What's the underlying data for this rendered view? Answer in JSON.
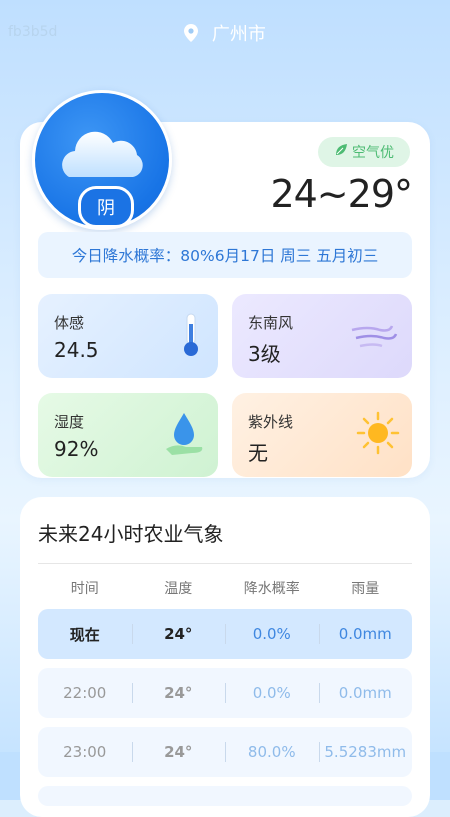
{
  "watermark": "fb3b5d",
  "location": {
    "city": "广州市"
  },
  "current": {
    "condition": "阴",
    "air_quality": "空气优",
    "temp_range": "24~29°",
    "precip_line": "今日降水概率：80%6月17日 周三 五月初三"
  },
  "tiles": {
    "feel": {
      "label": "体感",
      "value": "24.5",
      "icon": "thermometer-icon"
    },
    "wind": {
      "label": "东南风",
      "value": "3级",
      "icon": "wind-icon"
    },
    "humidity": {
      "label": "湿度",
      "value": "92%",
      "icon": "water-drop-icon"
    },
    "uv": {
      "label": "紫外线",
      "value": "无",
      "icon": "sun-icon"
    }
  },
  "forecast": {
    "title": "未来24小时农业气象",
    "headers": [
      "时间",
      "温度",
      "降水概率",
      "雨量"
    ],
    "rows": [
      {
        "time": "现在",
        "temp": "24°",
        "precip": "0.0%",
        "rain": "0.0mm"
      },
      {
        "time": "22:00",
        "temp": "24°",
        "precip": "0.0%",
        "rain": "0.0mm"
      },
      {
        "time": "23:00",
        "temp": "24°",
        "precip": "80.0%",
        "rain": "5.5283mm"
      }
    ]
  },
  "colors": {
    "accent": "#1874e6",
    "precip_text": "#2e77d6",
    "air_good": "#4dbb73"
  }
}
